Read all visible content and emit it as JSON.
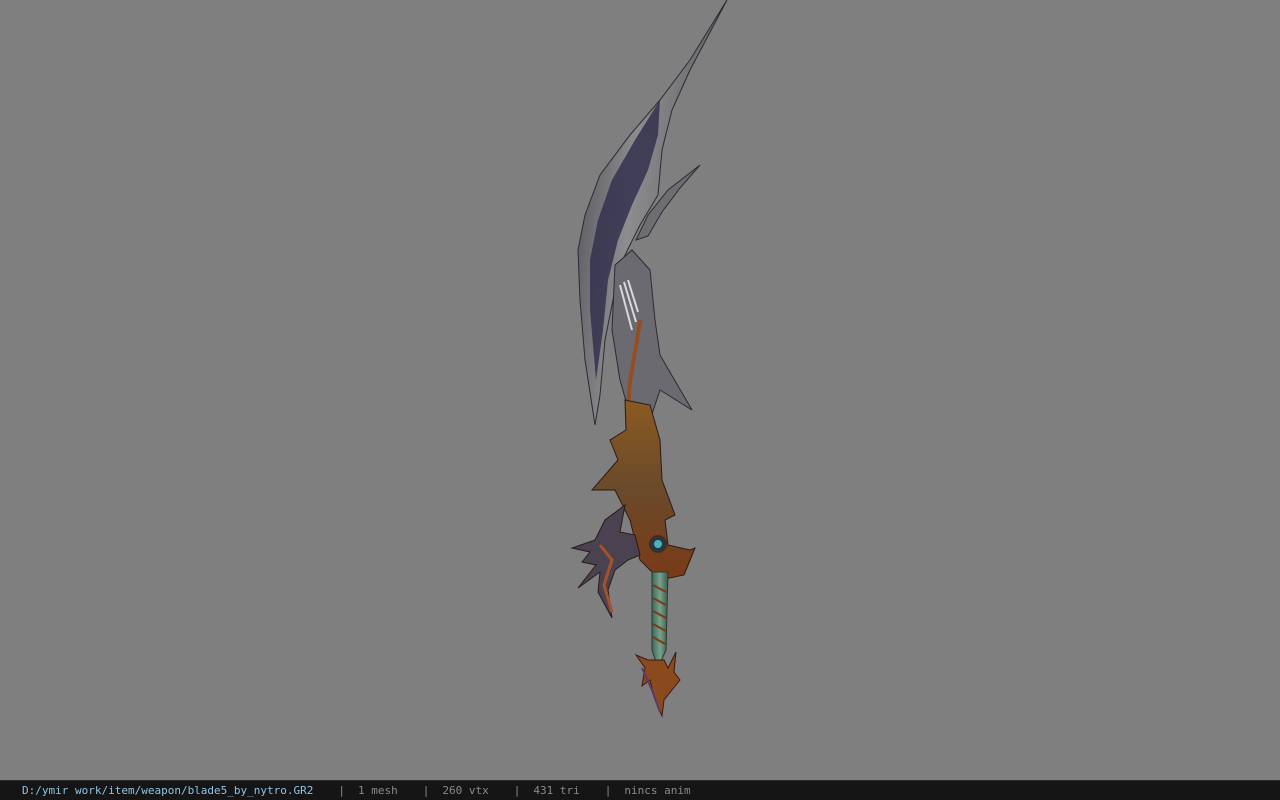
{
  "viewer": {
    "background_color": "#7f7f7f",
    "model_icon": "curved-blade-sword"
  },
  "status": {
    "file_path": "D:/ymir work/item/weapon/blade5_by_nytro.GR2",
    "separator": "|",
    "mesh": "1 mesh",
    "vertices": "260 vtx",
    "triangles": "431 tri",
    "animation": "nincs anim"
  }
}
